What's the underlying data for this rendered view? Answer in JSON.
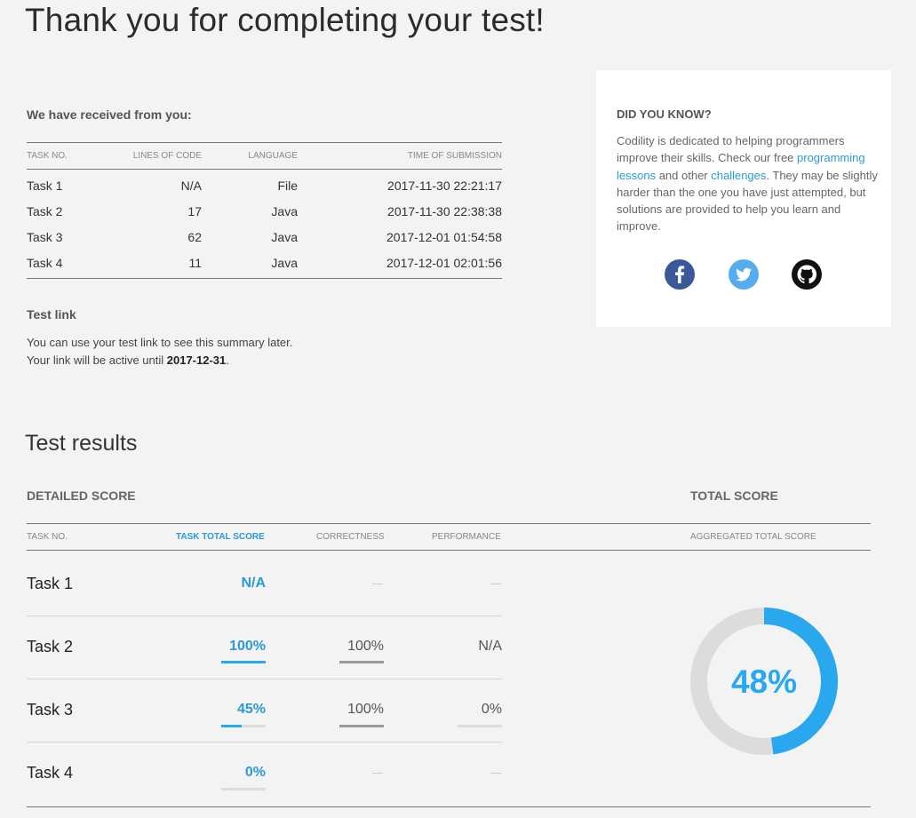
{
  "page": {
    "title": "Thank you for completing your test!"
  },
  "received": {
    "heading": "We have received from you:",
    "columns": [
      "TASK NO.",
      "LINES OF CODE",
      "LANGUAGE",
      "TIME OF SUBMISSION"
    ],
    "rows": [
      {
        "task": "Task 1",
        "lines": "N/A",
        "language": "File",
        "time": "2017-11-30 22:21:17"
      },
      {
        "task": "Task 2",
        "lines": "17",
        "language": "Java",
        "time": "2017-11-30 22:38:38"
      },
      {
        "task": "Task 3",
        "lines": "62",
        "language": "Java",
        "time": "2017-12-01 01:54:58"
      },
      {
        "task": "Task 4",
        "lines": "11",
        "language": "Java",
        "time": "2017-12-01 02:01:56"
      }
    ]
  },
  "test_link": {
    "heading": "Test link",
    "line1": "You can use your test link to see this summary later.",
    "line2_prefix": "Your link will be active until ",
    "active_until": "2017-12-31",
    "line2_suffix": "."
  },
  "did_you_know": {
    "heading": "DID YOU KNOW?",
    "text_part1": "Codility is dedicated to helping programmers improve their skills. Check our free ",
    "link1": "programming lessons",
    "text_part2": " and other ",
    "link2": "challenges",
    "text_part3": ". They may be slightly harder than the one you have just attempted, but solutions are provided to help you learn and improve.",
    "social": [
      "facebook-icon",
      "twitter-icon",
      "github-icon"
    ],
    "colors": {
      "facebook": "#3b5998",
      "twitter": "#55acee",
      "github": "#111111",
      "link": "#2a9ad8"
    }
  },
  "results": {
    "title": "Test results",
    "detailed_heading": "DETAILED SCORE",
    "total_heading": "TOTAL SCORE",
    "columns": {
      "task": "TASK NO.",
      "total": "TASK TOTAL SCORE",
      "correctness": "CORRECTNESS",
      "performance": "PERFORMANCE",
      "aggregated": "AGGREGATED TOTAL SCORE"
    },
    "tasks": [
      {
        "name": "Task 1",
        "score": "N/A",
        "score_fraction": null,
        "correctness": "—",
        "correctness_fraction": null,
        "performance": "—",
        "performance_fraction": null
      },
      {
        "name": "Task 2",
        "score": "100%",
        "score_fraction": 1.0,
        "correctness": "100%",
        "correctness_fraction": 1.0,
        "performance": "N/A",
        "performance_fraction": null
      },
      {
        "name": "Task 3",
        "score": "45%",
        "score_fraction": 0.45,
        "correctness": "100%",
        "correctness_fraction": 1.0,
        "performance": "0%",
        "performance_fraction": 0.0
      },
      {
        "name": "Task 4",
        "score": "0%",
        "score_fraction": 0.0,
        "correctness": "—",
        "correctness_fraction": null,
        "performance": "—",
        "performance_fraction": null
      }
    ],
    "total_score": "48%",
    "total_fraction": 0.48,
    "colors": {
      "accent": "#2aa8ef",
      "track": "#dcdcdc",
      "correctness_bar": "#999999"
    }
  }
}
